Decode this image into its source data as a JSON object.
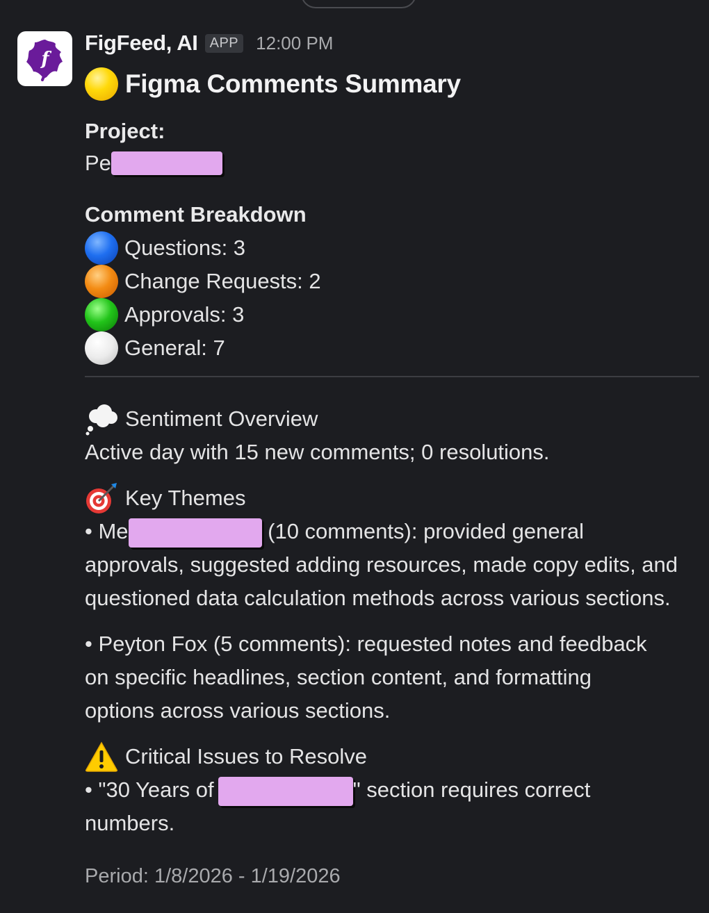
{
  "message": {
    "sender": "FigFeed, AI",
    "badge": "APP",
    "time": "12:00 PM",
    "title": "Figma Comments Summary",
    "project_label": "Project:",
    "project_value_visible": "Pe",
    "breakdown_title": "Comment Breakdown",
    "breakdown": [
      {
        "label": "Questions: 3",
        "icon": "blue-circle-icon"
      },
      {
        "label": "Change Requests: 2",
        "icon": "orange-circle-icon"
      },
      {
        "label": "Approvals: 3",
        "icon": "green-circle-icon"
      },
      {
        "label": "General: 7",
        "icon": "white-circle-icon"
      }
    ],
    "sentiment_title": "Sentiment Overview",
    "sentiment_text": "Active day with 15 new comments; 0 resolutions.",
    "themes_title": "Key Themes",
    "theme1_prefix": "• Me",
    "theme1_line1_rest": " (10 comments): provided general",
    "theme1_line2": "approvals, suggested adding resources, made copy edits, and",
    "theme1_line3": "questioned data calculation methods across various sections.",
    "theme2_line1": "• Peyton Fox (5 comments): requested notes and feedback",
    "theme2_line2": "on specific headlines, section content, and formatting",
    "theme2_line3": "options across various sections.",
    "issues_title": "Critical Issues to Resolve",
    "issue1_prefix": "• \"30 Years of",
    "issue1_rest": "\" section requires correct",
    "issue1_line2": "numbers.",
    "period": "Period: 1/8/2026 - 1/19/2026"
  },
  "colors": {
    "background": "#1c1d21",
    "redaction": "#e2a8ee",
    "logo": "#6a1b9a"
  }
}
